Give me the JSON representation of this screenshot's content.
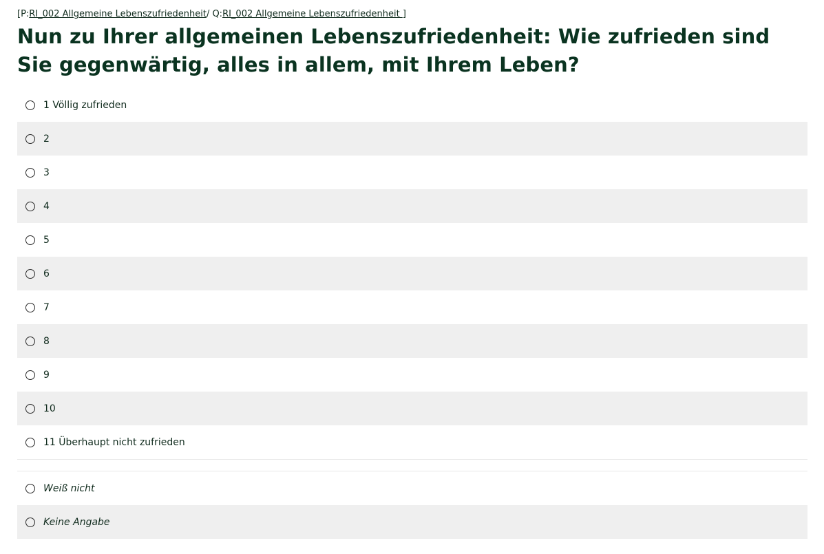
{
  "breadcrumb": {
    "open": "[P:",
    "page_link": "RI_002 Allgemeine Lebenszufriedenheit",
    "separator": "/ Q:",
    "question_link": "RI_002 Allgemeine Lebenszufriedenheit ",
    "close": "]"
  },
  "question": {
    "text": "Nun zu Ihrer allgemeinen Lebenszufriedenheit: Wie zufrieden sind Sie gegenwärtig, alles in allem, mit Ihrem Leben?"
  },
  "options": [
    {
      "label": "1 Völlig zufrieden",
      "selected": false
    },
    {
      "label": "2",
      "selected": false
    },
    {
      "label": "3",
      "selected": false
    },
    {
      "label": "4",
      "selected": false
    },
    {
      "label": "5",
      "selected": false
    },
    {
      "label": "6",
      "selected": false
    },
    {
      "label": "7",
      "selected": false
    },
    {
      "label": "8",
      "selected": false
    },
    {
      "label": "9",
      "selected": false
    },
    {
      "label": "10",
      "selected": false
    },
    {
      "label": "11 Überhaupt nicht zufrieden",
      "selected": false
    }
  ],
  "special_options": [
    {
      "label": "Weiß nicht",
      "selected": false
    },
    {
      "label": "Keine Angabe",
      "selected": false
    }
  ],
  "colors": {
    "heading": "#0a3320",
    "text": "#0f2a1c",
    "row_alt_bg": "#efefef"
  }
}
